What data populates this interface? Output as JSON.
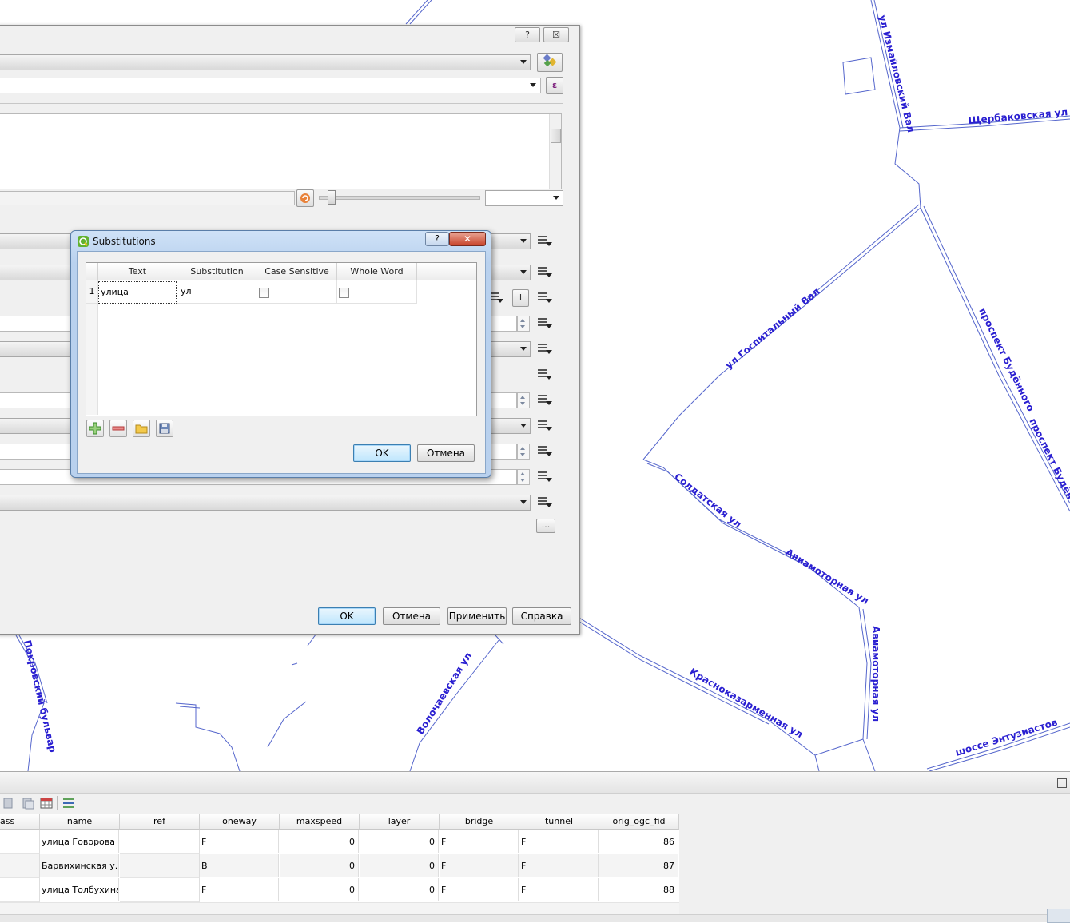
{
  "map": {
    "streets": [
      {
        "id": "izmailovsky",
        "label": "ул Измайловский Вал"
      },
      {
        "id": "shcherbakovskaya",
        "label": "Щербаковская ул"
      },
      {
        "id": "gospitalny",
        "label": "ул Госпитальный Вал"
      },
      {
        "id": "budyonnogo1",
        "label": "проспект Будённого"
      },
      {
        "id": "budyonnogo2",
        "label": "проспект Будён"
      },
      {
        "id": "soldatskaya",
        "label": "Солдатская ул"
      },
      {
        "id": "aviamotornaya1",
        "label": "Авиамоторная ул"
      },
      {
        "id": "aviamotornaya2",
        "label": "Авиамоторная ул"
      },
      {
        "id": "krasnokazarmennaya",
        "label": "Красноказарменная ул"
      },
      {
        "id": "volochaevskaya",
        "label": "Волочаевская ул"
      },
      {
        "id": "pokrovsky",
        "label": "Покровский бульвар"
      },
      {
        "id": "entuziastov",
        "label": "шоссе Энтузиастов"
      }
    ]
  },
  "layer_props": {
    "help_button": "?",
    "close_button": "☒",
    "expression_icon": "ε",
    "ellipsis_button": "...",
    "ok_button": "OK",
    "cancel_button": "Отмена",
    "apply_button": "Применить",
    "help_label": "Справка",
    "field_icon": "I"
  },
  "substitutions": {
    "title": "Substitutions",
    "help_button": "?",
    "columns": [
      "Text",
      "Substitution",
      "Case Sensitive",
      "Whole Word"
    ],
    "rows": [
      {
        "index": "1",
        "text": "улица",
        "substitution": "ул",
        "case_sensitive": false,
        "whole_word": false
      }
    ],
    "ok_button": "OK",
    "cancel_button": "Отмена"
  },
  "attribute_table": {
    "columns": [
      "ass",
      "name",
      "ref",
      "oneway",
      "maxspeed",
      "layer",
      "bridge",
      "tunnel",
      "orig_ogc_fid"
    ],
    "rows": [
      {
        "name": "улица Говорова",
        "ref": "",
        "oneway": "F",
        "maxspeed": "0",
        "layer": "0",
        "bridge": "F",
        "tunnel": "F",
        "fid": "86"
      },
      {
        "name": "Барвихинская у...",
        "ref": "",
        "oneway": "B",
        "maxspeed": "0",
        "layer": "0",
        "bridge": "F",
        "tunnel": "F",
        "fid": "87"
      },
      {
        "name": "улица Толбухина",
        "ref": "",
        "oneway": "F",
        "maxspeed": "0",
        "layer": "0",
        "bridge": "F",
        "tunnel": "F",
        "fid": "88"
      }
    ]
  },
  "colors": {
    "road": "#5566cc",
    "label": "#2a1fd1",
    "dialog_bg": "#f0f0f0",
    "title_blue": "#b9d1ee"
  }
}
